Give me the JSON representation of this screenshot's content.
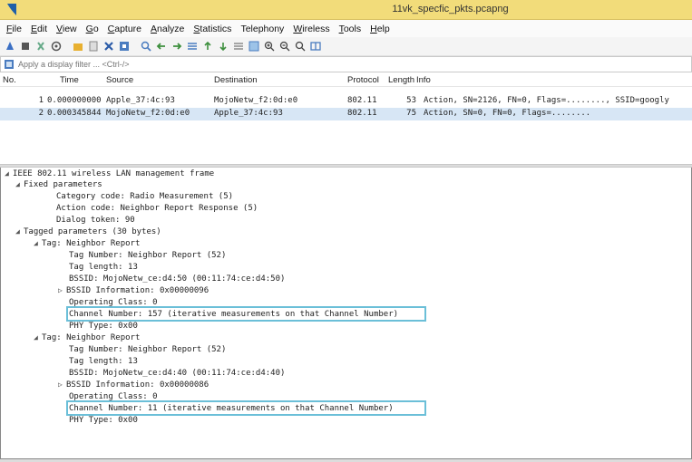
{
  "window": {
    "title": "11vk_specfic_pkts.pcapng"
  },
  "menus": [
    {
      "label": "File",
      "ul": "F",
      "rest": "ile"
    },
    {
      "label": "Edit",
      "ul": "E",
      "rest": "dit"
    },
    {
      "label": "View",
      "ul": "V",
      "rest": "iew"
    },
    {
      "label": "Go",
      "ul": "G",
      "rest": "o"
    },
    {
      "label": "Capture",
      "ul": "C",
      "rest": "apture"
    },
    {
      "label": "Analyze",
      "ul": "A",
      "rest": "nalyze"
    },
    {
      "label": "Statistics",
      "ul": "S",
      "rest": "tatistics"
    },
    {
      "label": "Telephony",
      "ul": "",
      "rest": "Telephony"
    },
    {
      "label": "Wireless",
      "ul": "W",
      "rest": "ireless"
    },
    {
      "label": "Tools",
      "ul": "T",
      "rest": "ools"
    },
    {
      "label": "Help",
      "ul": "H",
      "rest": "elp"
    }
  ],
  "filter": {
    "placeholder": "Apply a display filter ... <Ctrl-/>"
  },
  "packet_list": {
    "columns": {
      "no": "No.",
      "time": "Time",
      "source": "Source",
      "destination": "Destination",
      "protocol": "Protocol",
      "length": "Length",
      "info": "Info"
    },
    "rows": [
      {
        "no": "1",
        "time": "0.000000000",
        "source": "Apple_37:4c:93",
        "destination": "MojoNetw_f2:0d:e0",
        "protocol": "802.11",
        "length": "53",
        "info": "Action, SN=2126, FN=0, Flags=........, SSID=googly"
      },
      {
        "no": "2",
        "time": "0.000345844",
        "source": "MojoNetw_f2:0d:e0",
        "destination": "Apple_37:4c:93",
        "protocol": "802.11",
        "length": "75",
        "info": "Action, SN=0, FN=0, Flags=........"
      }
    ]
  },
  "details": {
    "lines": [
      {
        "text": "IEEE 802.11 wireless LAN management frame",
        "arrow": "open"
      },
      {
        "text": "Fixed parameters",
        "arrow": "open"
      },
      {
        "text": "Category code: Radio Measurement (5)",
        "arrow": ""
      },
      {
        "text": "Action code: Neighbor Report Response (5)",
        "arrow": ""
      },
      {
        "text": "Dialog token: 90",
        "arrow": ""
      },
      {
        "text": "Tagged parameters (30 bytes)",
        "arrow": "open"
      },
      {
        "text": "Tag: Neighbor Report",
        "arrow": "open"
      },
      {
        "text": "Tag Number: Neighbor Report (52)",
        "arrow": ""
      },
      {
        "text": "Tag length: 13",
        "arrow": ""
      },
      {
        "text": "BSSID: MojoNetw_ce:d4:50 (00:11:74:ce:d4:50)",
        "arrow": ""
      },
      {
        "text": "BSSID Information: 0x00000096",
        "arrow": "closed"
      },
      {
        "text": "Operating Class: 0",
        "arrow": ""
      },
      {
        "text": "Channel Number: 157 (iterative measurements on that Channel Number)",
        "arrow": ""
      },
      {
        "text": "PHY Type: 0x00",
        "arrow": ""
      },
      {
        "text": "Tag: Neighbor Report",
        "arrow": "open"
      },
      {
        "text": "Tag Number: Neighbor Report (52)",
        "arrow": ""
      },
      {
        "text": "Tag length: 13",
        "arrow": ""
      },
      {
        "text": "BSSID: MojoNetw_ce:d4:40 (00:11:74:ce:d4:40)",
        "arrow": ""
      },
      {
        "text": "BSSID Information: 0x00000086",
        "arrow": "closed"
      },
      {
        "text": "Operating Class: 0",
        "arrow": ""
      },
      {
        "text": "Channel Number: 11 (iterative measurements on that Channel Number)",
        "arrow": ""
      },
      {
        "text": "PHY Type: 0x00",
        "arrow": ""
      }
    ]
  },
  "colors": {
    "title_bar": "#f2dc7a",
    "highlight_box": "#6bbfd8",
    "selected_row": "#d7e6f5"
  }
}
